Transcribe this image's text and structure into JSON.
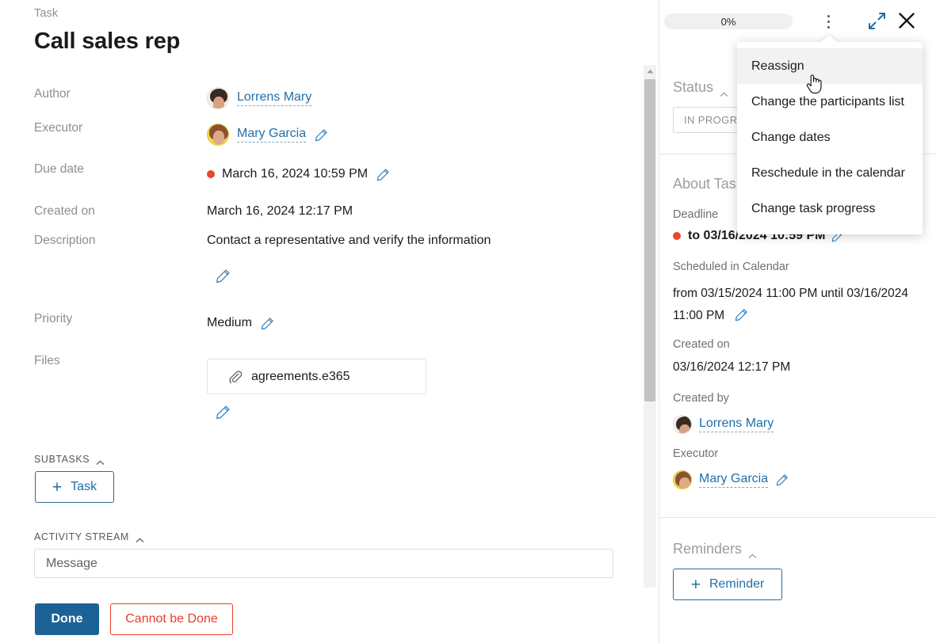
{
  "header": {
    "eyebrow": "Task",
    "title": "Call sales rep",
    "progress_label": "0%",
    "progress_value": 0,
    "kebab_icon": "kebab-menu-icon",
    "expand_icon": "expand-icon",
    "close_icon": "close-icon"
  },
  "fields": {
    "author": {
      "label": "Author",
      "value": "Lorrens Mary"
    },
    "executor": {
      "label": "Executor",
      "value": "Mary Garcia"
    },
    "due_date": {
      "label": "Due date",
      "value": "March 16, 2024 10:59 PM",
      "marker_color": "#e8472a"
    },
    "created_on": {
      "label": "Created on",
      "value": "March 16, 2024 12:17 PM"
    },
    "description": {
      "label": "Description",
      "value": "Contact a representative and verify the information"
    },
    "priority": {
      "label": "Priority",
      "value": "Medium"
    },
    "files": {
      "label": "Files",
      "value": "agreements.e365"
    }
  },
  "subtasks": {
    "heading": "SUBTASKS",
    "add_button": "Task",
    "add_button_plus": "+"
  },
  "activity_stream": {
    "heading": "ACTIVITY STREAM",
    "message_placeholder": "Message",
    "message_value": ""
  },
  "actions": {
    "done": "Done",
    "cannot_be_done": "Cannot be Done"
  },
  "sidebar": {
    "status": {
      "heading": "Status",
      "value": "IN PROGRESS"
    },
    "about": {
      "heading": "About Task",
      "deadline_label": "Deadline",
      "deadline_value": "to 03/16/2024 10:59 PM",
      "scheduled_label": "Scheduled in Calendar",
      "scheduled_value": "from 03/15/2024 11:00 PM until 03/16/2024 11:00 PM",
      "created_on_label": "Created on",
      "created_on_value": "03/16/2024 12:17 PM",
      "created_by_label": "Created by",
      "created_by_value": "Lorrens Mary",
      "executor_label": "Executor",
      "executor_value": "Mary Garcia"
    },
    "reminders": {
      "heading": "Reminders",
      "add_button": "Reminder",
      "add_button_plus": "+"
    }
  },
  "dropdown": {
    "items": [
      {
        "label": "Reassign",
        "active": true
      },
      {
        "label": "Change the participants list",
        "active": false
      },
      {
        "label": "Change dates",
        "active": false
      },
      {
        "label": "Reschedule in the calendar",
        "active": false
      },
      {
        "label": "Change task progress",
        "active": false
      }
    ]
  },
  "colors": {
    "accent_blue": "#1f6fa8",
    "danger_red": "#ea3c2d",
    "overdue_dot": "#e8472a",
    "primary_button": "#1c6296"
  }
}
